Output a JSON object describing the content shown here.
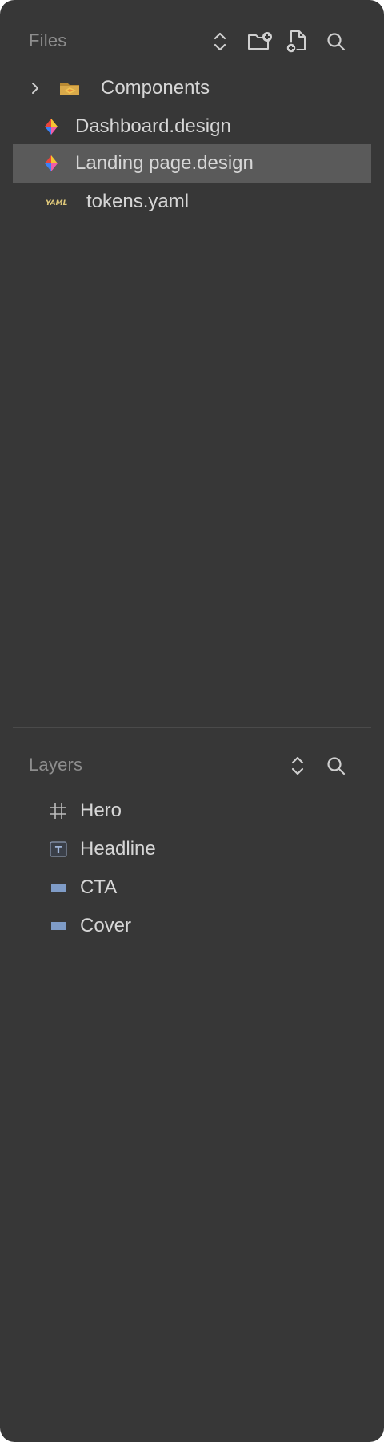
{
  "files": {
    "title": "Files",
    "toolbar": {
      "expand_collapse_icon": "chevron-up-down-icon",
      "new_folder_icon": "folder-plus-icon",
      "new_file_icon": "document-plus-icon",
      "search_icon": "magnifier-icon"
    },
    "items": [
      {
        "label": "Components",
        "icon": "folder-icon",
        "type": "folder",
        "expanded": false
      },
      {
        "label": "Dashboard.design",
        "icon": "design-file-icon",
        "type": "file"
      },
      {
        "label": "Landing page.design",
        "icon": "design-file-icon",
        "type": "file",
        "selected": true
      },
      {
        "label": "tokens.yaml",
        "icon": "yaml-file-icon",
        "type": "file",
        "badge": "YAML"
      }
    ]
  },
  "layers": {
    "title": "Layers",
    "toolbar": {
      "expand_collapse_icon": "chevron-up-down-icon",
      "search_icon": "magnifier-icon"
    },
    "items": [
      {
        "label": "Hero",
        "icon": "frame-hash-icon"
      },
      {
        "label": "Headline",
        "icon": "text-layer-icon",
        "glyph": "T"
      },
      {
        "label": "CTA",
        "icon": "rectangle-layer-icon"
      },
      {
        "label": "Cover",
        "icon": "rectangle-layer-icon"
      }
    ]
  },
  "colors": {
    "panel_bg": "#373737",
    "selection": "#5a5a5a",
    "text": "#d6d6d6",
    "section_title": "#8e8e8e",
    "icon": "#cfcfcf",
    "rect_layer": "#7f9cc7",
    "yaml_badge": "#e0c97a",
    "folder": "#d9a94a"
  }
}
